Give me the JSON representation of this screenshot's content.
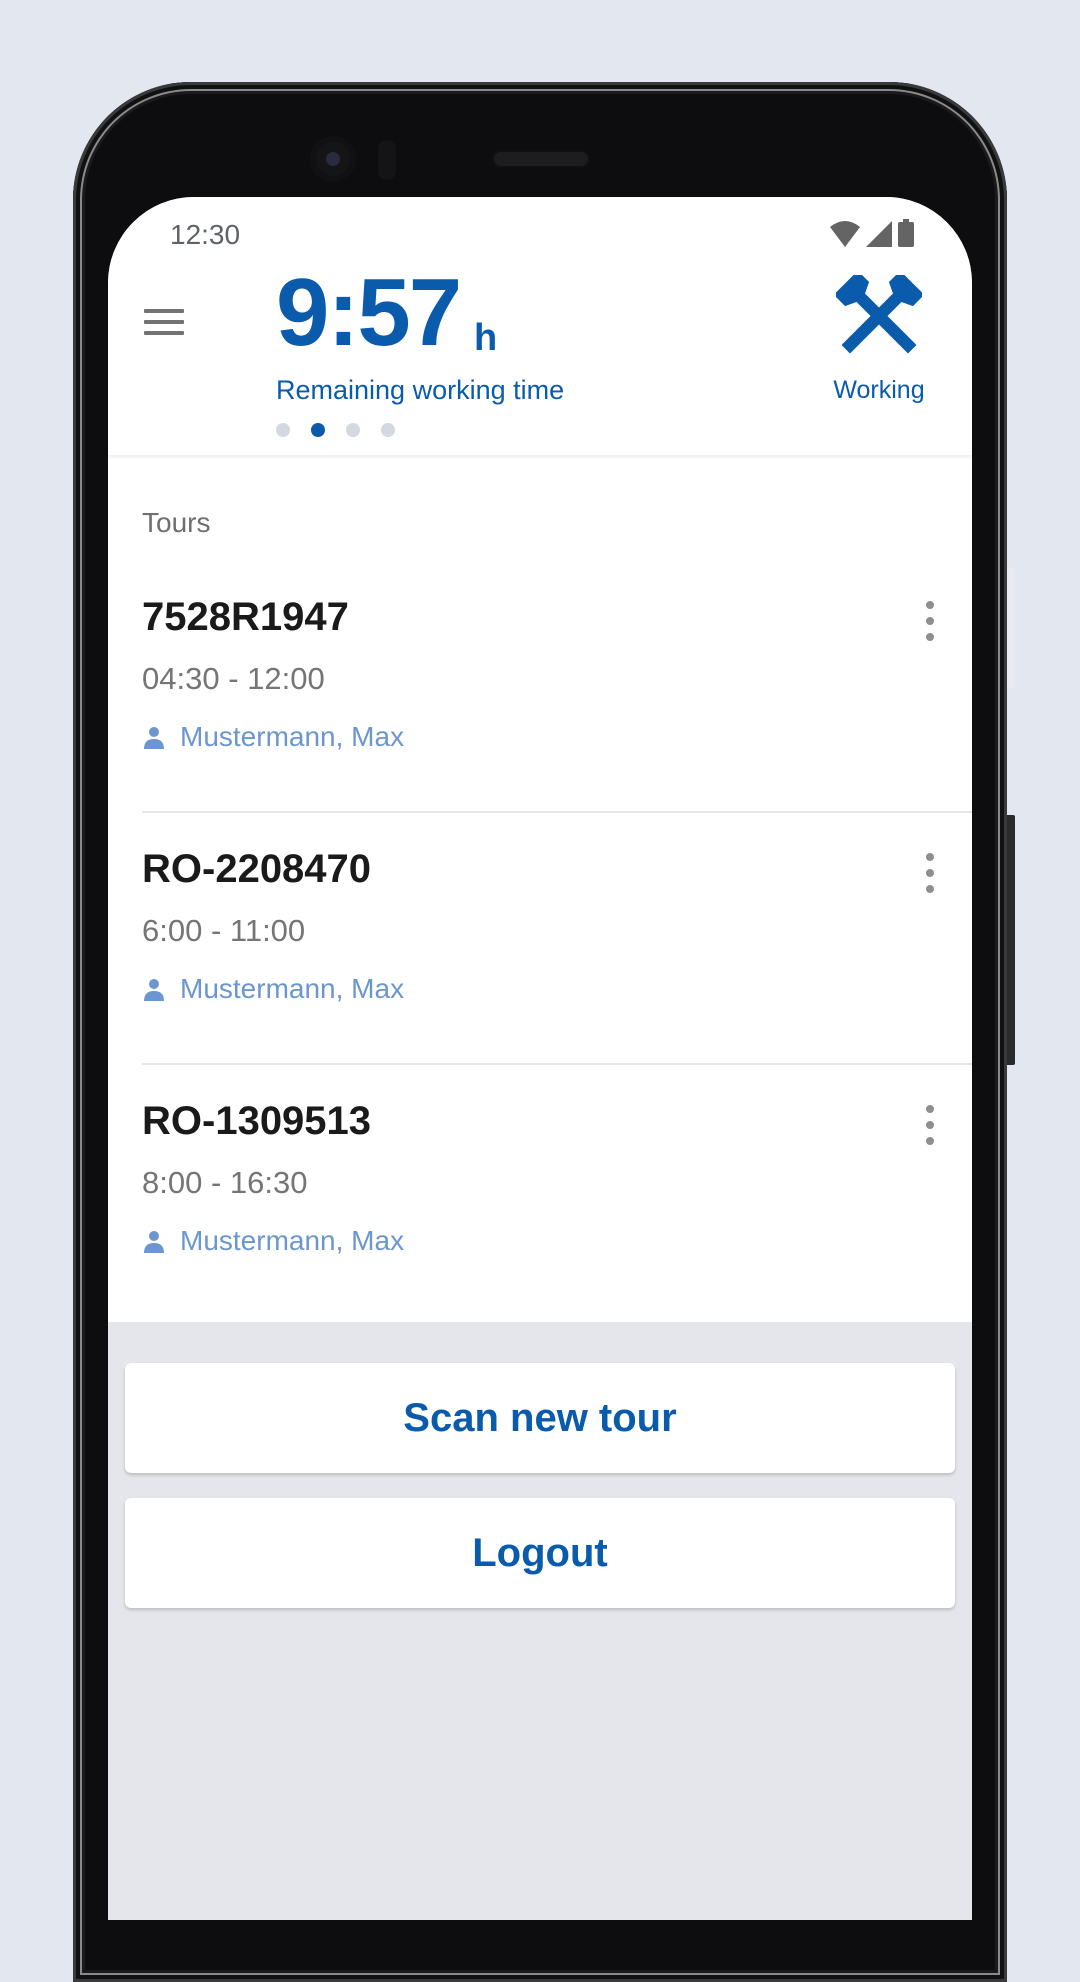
{
  "device": {
    "status_bar": {
      "time": "12:30",
      "icons": [
        "wifi-icon",
        "cellular-signal-icon",
        "battery-icon"
      ]
    }
  },
  "header": {
    "menu_icon": "hamburger-menu-icon",
    "remaining_time": "9:57",
    "remaining_time_unit": "h",
    "remaining_time_label": "Remaining working time",
    "pager": {
      "count": 4,
      "active_index": 1
    },
    "status": {
      "icon": "crossed-hammers-icon",
      "label": "Working"
    }
  },
  "tours": {
    "section_title": "Tours",
    "items": [
      {
        "id": "7528R1947",
        "time": "04:30 - 12:00",
        "driver": "Mustermann, Max"
      },
      {
        "id": "RO-2208470",
        "time": "6:00 - 11:00",
        "driver": "Mustermann, Max"
      },
      {
        "id": "RO-1309513",
        "time": "8:00 - 16:30",
        "driver": "Mustermann, Max"
      }
    ]
  },
  "actions": {
    "scan_label": "Scan new tour",
    "logout_label": "Logout"
  },
  "colors": {
    "brand": "#0a5bab",
    "driver_text": "#6b96cf",
    "background": "#e4e6eb"
  }
}
